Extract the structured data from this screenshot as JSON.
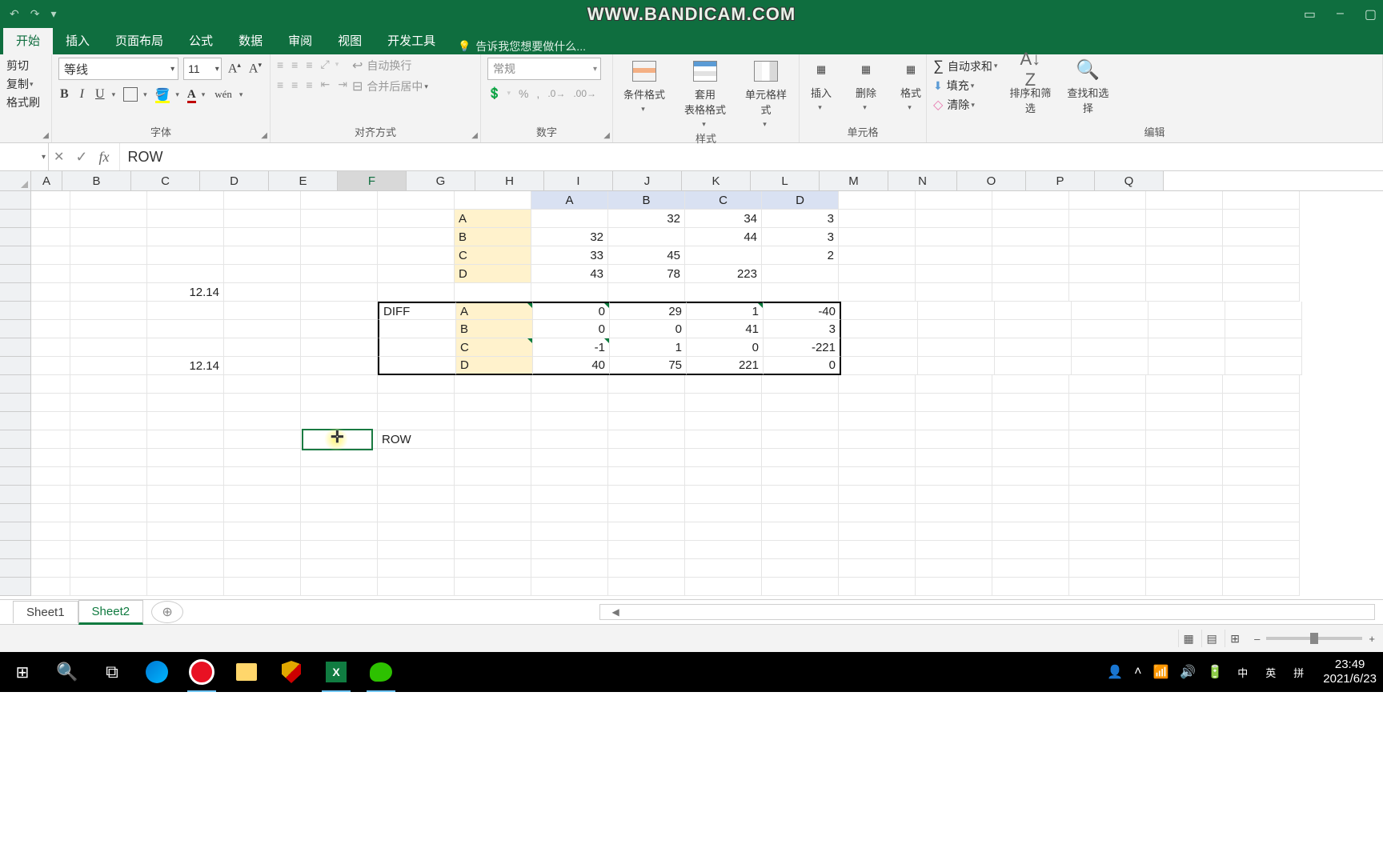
{
  "watermark": "WWW.BANDICAM.COM",
  "ribbon": {
    "tabs": [
      "开始",
      "插入",
      "页面布局",
      "公式",
      "数据",
      "审阅",
      "视图",
      "开发工具"
    ],
    "tellme": "告诉我您想要做什么...",
    "clipboard": {
      "cut": "剪切",
      "copy": "复制",
      "brush": "格式刷"
    },
    "font": {
      "name": "等线",
      "size": "11",
      "label": "字体",
      "bold": "B",
      "italic": "I",
      "underline": "U"
    },
    "align": {
      "label": "对齐方式",
      "wrap": "自动换行",
      "merge": "合并后居中"
    },
    "number": {
      "label": "数字",
      "fmt": "常规"
    },
    "styles": {
      "label": "样式",
      "cf": "条件格式",
      "table": "套用\n表格格式",
      "cell": "单元格样式"
    },
    "cells": {
      "label": "单元格",
      "insert": "插入",
      "delete": "删除",
      "format": "格式"
    },
    "editing": {
      "label": "编辑",
      "sum": "自动求和",
      "fill": "填充",
      "clear": "清除",
      "sort": "排序和筛选",
      "find": "查找和选择"
    }
  },
  "formula_bar": {
    "name_box": "",
    "fx": "fx",
    "input": "ROW"
  },
  "columns": [
    "A",
    "B",
    "C",
    "D",
    "E",
    "F",
    "G",
    "H",
    "I",
    "J",
    "K",
    "L",
    "M",
    "N",
    "O",
    "P",
    "Q"
  ],
  "sheet": {
    "hdrA": "A",
    "hdrB": "B",
    "hdrC": "C",
    "hdrD": "D",
    "rA": "A",
    "rB": "B",
    "rC": "C",
    "rD": "D",
    "r2i": "32",
    "r2j": "34",
    "r2k": "3",
    "r3h": "32",
    "r3j": "44",
    "r3k": "3",
    "r4h": "33",
    "r4i": "45",
    "r4k": "2",
    "r5h": "43",
    "r5i": "78",
    "r5j": "223",
    "c6": "12.14",
    "diff": "DIFF",
    "d7g": "A",
    "d7h": "0",
    "d7i": "29",
    "d7j": "1",
    "d7k": "-40",
    "d8g": "B",
    "d8h": "0",
    "d8i": "0",
    "d8j": "41",
    "d8k": "3",
    "d9g": "C",
    "d9h": "-1",
    "d9i": "1",
    "d9j": "0",
    "d9k": "-221",
    "d10g": "D",
    "d10h": "40",
    "d10i": "75",
    "d10j": "221",
    "d10k": "0",
    "c10": "12.14",
    "f14": "ROW"
  },
  "tabs": {
    "s1": "Sheet1",
    "s2": "Sheet2"
  },
  "tray": {
    "ime1": "中",
    "ime2": "英",
    "ime3": "拼"
  },
  "clock": {
    "time": "23:49",
    "date": "2021/6/23"
  }
}
